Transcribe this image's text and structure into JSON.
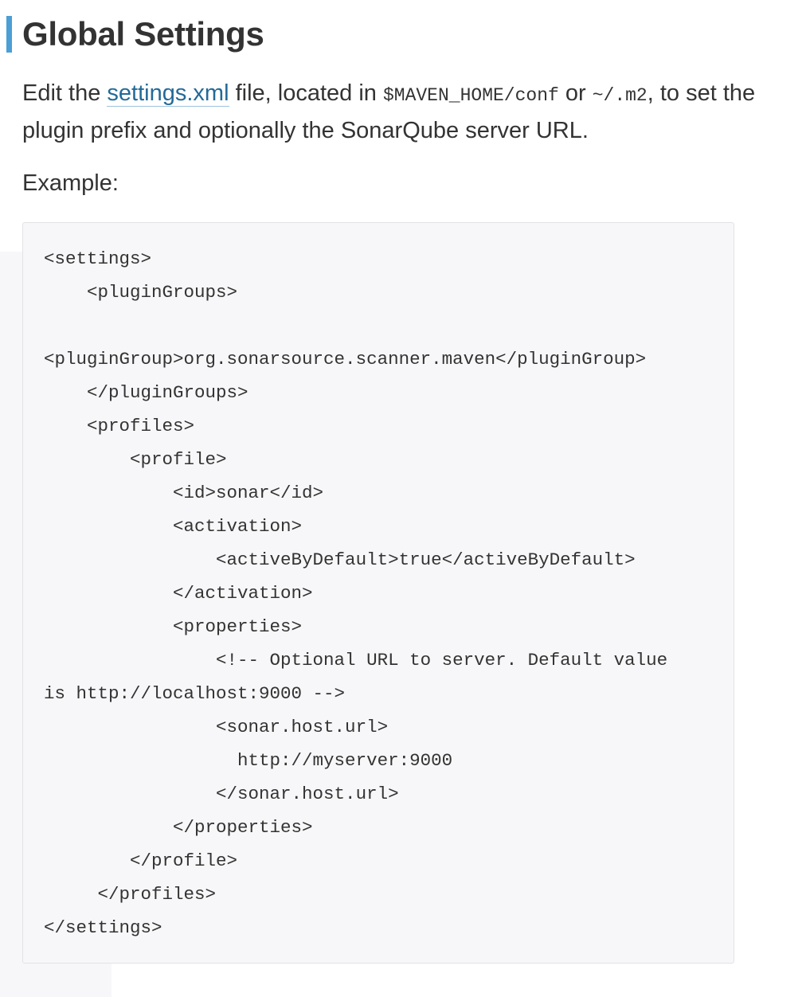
{
  "heading": "Global Settings",
  "intro": {
    "part1": "Edit the ",
    "link_text": "settings.xml",
    "part2": " file, located in ",
    "code1": "$MAVEN_HOME/conf",
    "part3": " or ",
    "code2": "~/.m2",
    "part4": ", to set the plugin prefix and optionally the SonarQube server URL."
  },
  "example_label": "Example:",
  "code_lines": [
    "<settings>",
    "    <pluginGroups>",
    "",
    "<pluginGroup>org.sonarsource.scanner.maven</pluginGroup>",
    "    </pluginGroups>",
    "    <profiles>",
    "        <profile>",
    "            <id>sonar</id>",
    "            <activation>",
    "                <activeByDefault>true</activeByDefault>",
    "            </activation>",
    "            <properties>",
    "                <!-- Optional URL to server. Default value",
    "is http://localhost:9000 -->",
    "                <sonar.host.url>",
    "                  http://myserver:9000",
    "                </sonar.host.url>",
    "            </properties>",
    "        </profile>",
    "     </profiles>",
    "</settings>"
  ]
}
